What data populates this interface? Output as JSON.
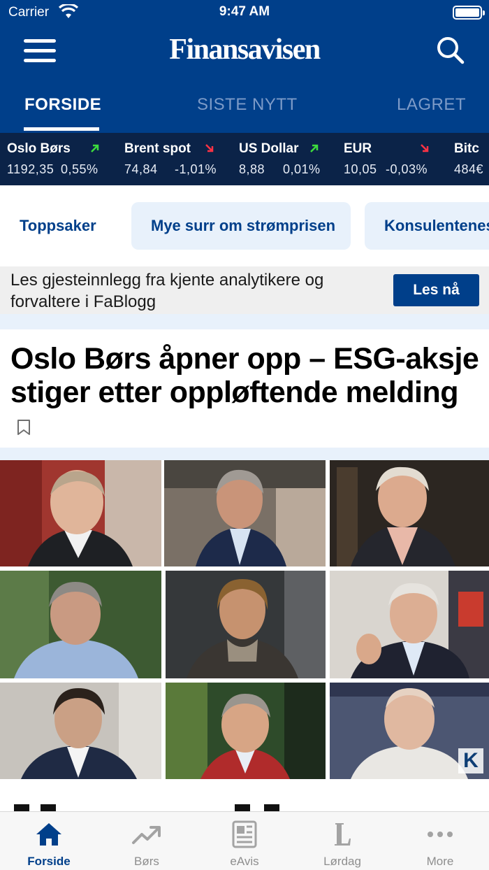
{
  "status_bar": {
    "carrier": "Carrier",
    "time": "9:47 AM"
  },
  "header": {
    "logo": "Finansavisen",
    "tabs": [
      {
        "label": "FORSIDE",
        "active": true
      },
      {
        "label": "SISTE NYTT",
        "active": false
      },
      {
        "label": "LAGRET",
        "active": false
      }
    ]
  },
  "ticker": [
    {
      "name": "Oslo Børs",
      "value": "1192,35",
      "change": "0,55%",
      "direction": "up"
    },
    {
      "name": "Brent spot",
      "value": "74,84",
      "change": "-1,01%",
      "direction": "down"
    },
    {
      "name": "US Dollar",
      "value": "8,88",
      "change": "0,01%",
      "direction": "up"
    },
    {
      "name": "EUR",
      "value": "10,05",
      "change": "-0,03%",
      "direction": "down"
    },
    {
      "name": "Bitc",
      "value": "484€",
      "change": "",
      "direction": ""
    }
  ],
  "chips": [
    {
      "label": "Toppsaker"
    },
    {
      "label": "Mye surr om strømprisen"
    },
    {
      "label": "Konsulentenes"
    }
  ],
  "promo": {
    "text": "Les gjesteinnlegg fra kjente analytikere og forvaltere i FaBlogg",
    "button": "Les nå"
  },
  "article": {
    "headline": "Oslo Børs åpner opp – ESG-aksje stiger etter oppløftende melding"
  },
  "photo_grid": {
    "badge": "K"
  },
  "tab_bar": [
    {
      "label": "Forside",
      "icon": "home-icon",
      "active": true
    },
    {
      "label": "Børs",
      "icon": "trending-up-icon",
      "active": false
    },
    {
      "label": "eAvis",
      "icon": "newspaper-icon",
      "active": false
    },
    {
      "label": "Lørdag",
      "icon": "letter-l-icon",
      "active": false
    },
    {
      "label": "More",
      "icon": "more-dots-icon",
      "active": false
    }
  ],
  "colors": {
    "brand_blue": "#003f8a",
    "ticker_bg": "#0b2348",
    "up": "#3ddc3d",
    "down": "#ff3344",
    "chip_bg": "#e8f1fb"
  }
}
